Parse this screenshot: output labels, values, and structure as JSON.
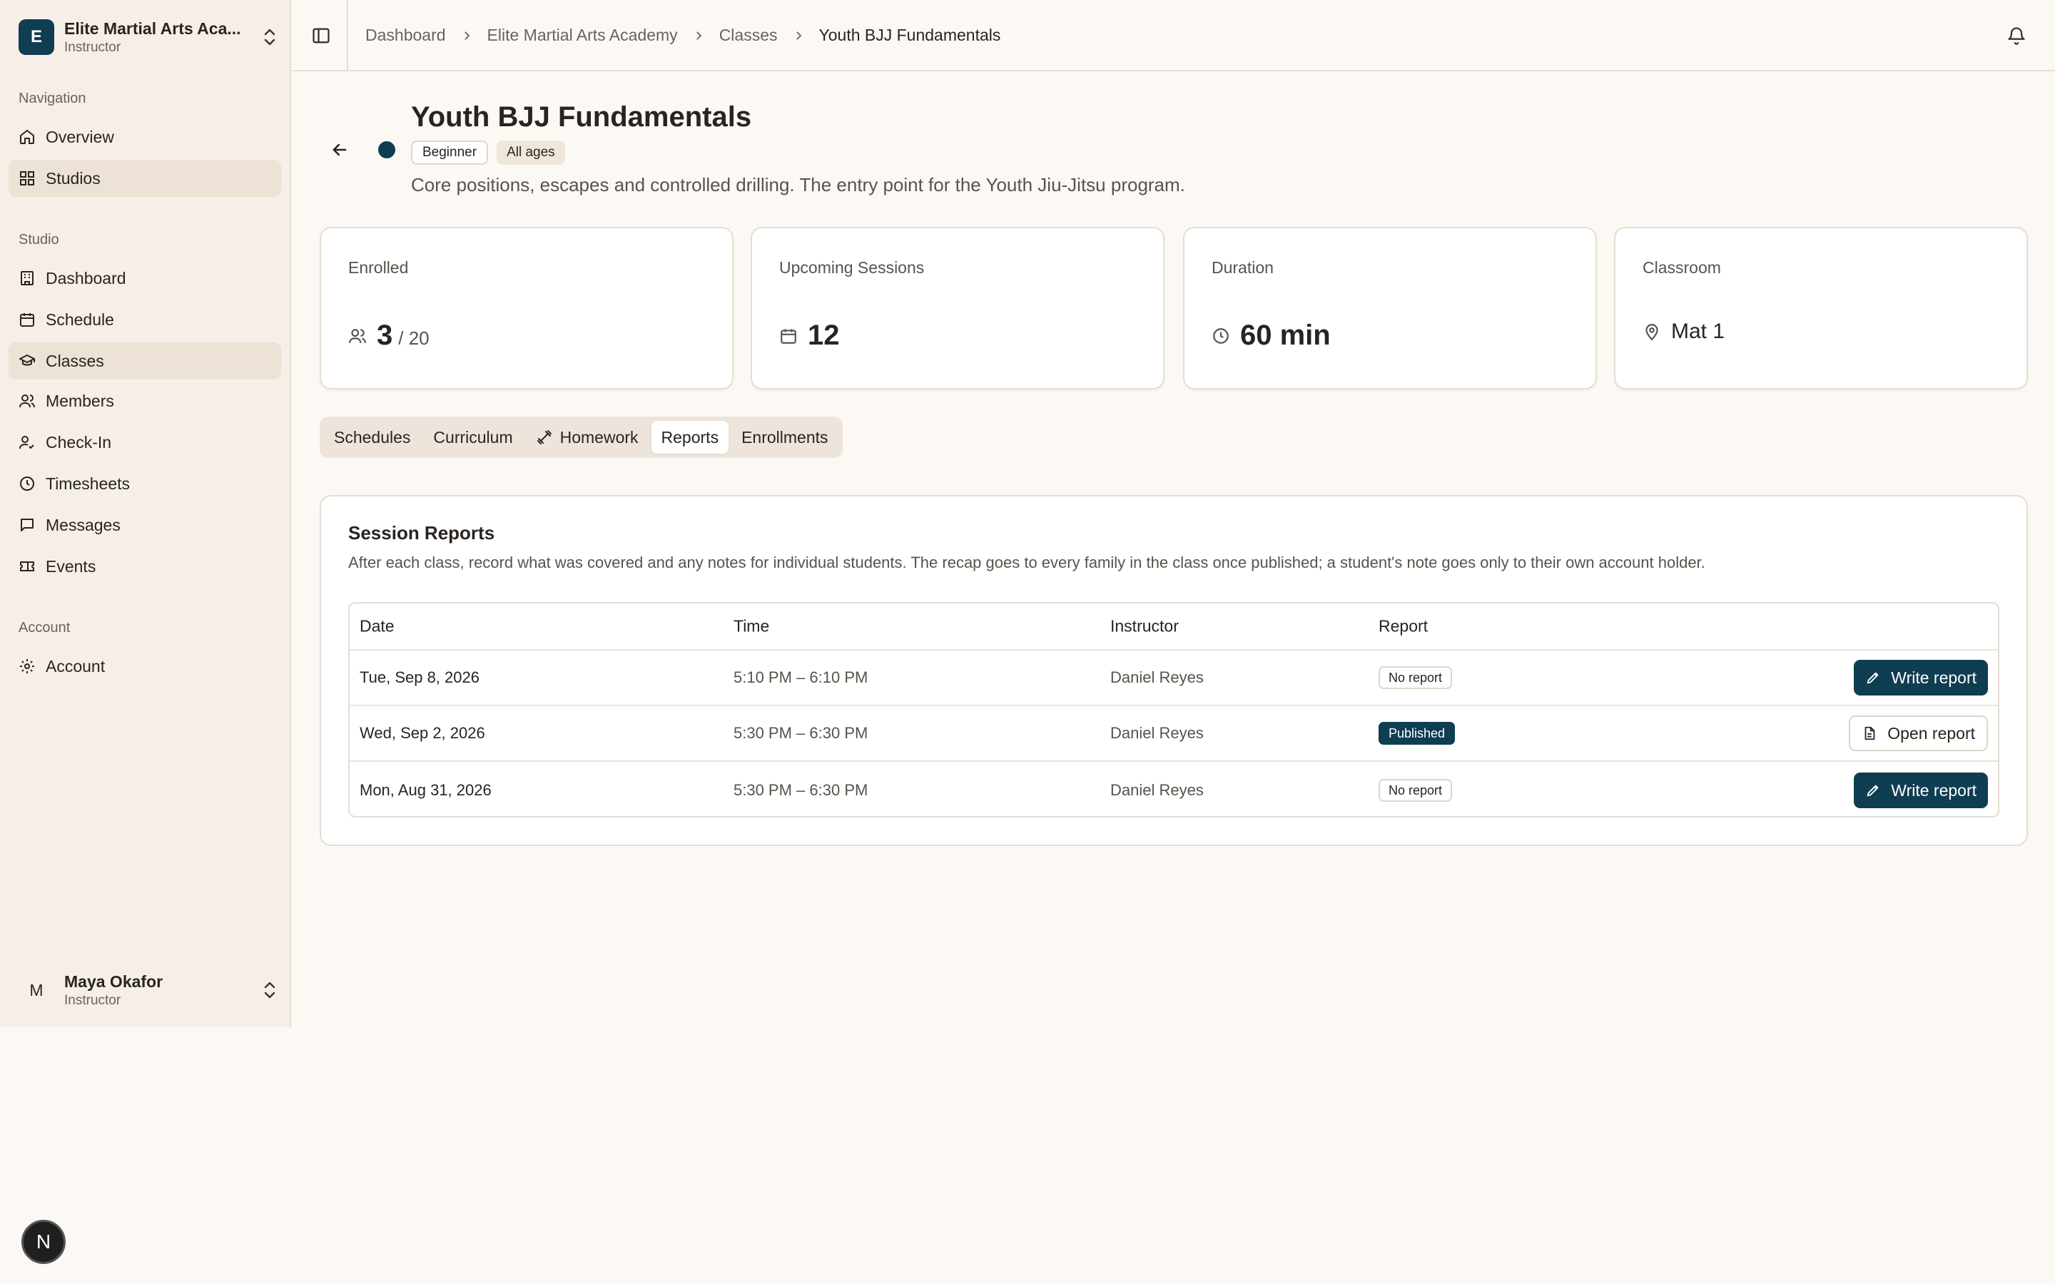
{
  "org": {
    "initial": "E",
    "name": "Elite Martial Arts Aca...",
    "role": "Instructor"
  },
  "sidebar": {
    "sections": {
      "navigation": "Navigation",
      "studio": "Studio",
      "account": "Account"
    },
    "navigation_items": [
      {
        "label": "Overview",
        "icon": "home-icon"
      },
      {
        "label": "Studios",
        "icon": "grid-icon"
      }
    ],
    "studio_items": [
      {
        "label": "Dashboard",
        "icon": "building-icon"
      },
      {
        "label": "Schedule",
        "icon": "calendar-icon"
      },
      {
        "label": "Classes",
        "icon": "graduation-cap-icon"
      },
      {
        "label": "Members",
        "icon": "users-icon"
      },
      {
        "label": "Check-In",
        "icon": "user-check-icon"
      },
      {
        "label": "Timesheets",
        "icon": "clock-icon"
      },
      {
        "label": "Messages",
        "icon": "message-icon"
      },
      {
        "label": "Events",
        "icon": "ticket-icon"
      }
    ],
    "account_items": [
      {
        "label": "Account",
        "icon": "gear-icon"
      }
    ]
  },
  "user": {
    "initial": "M",
    "name": "Maya Okafor",
    "role": "Instructor"
  },
  "breadcrumb": [
    "Dashboard",
    "Elite Martial Arts Academy",
    "Classes",
    "Youth BJJ Fundamentals"
  ],
  "class": {
    "title": "Youth BJJ Fundamentals",
    "badges": [
      "Beginner",
      "All ages"
    ],
    "description": "Core positions, escapes and controlled drilling. The entry point for the Youth Jiu-Jitsu program.",
    "color": "#0f3d52"
  },
  "stats": {
    "enrolled": {
      "label": "Enrolled",
      "value": "3",
      "capacity": "/ 20"
    },
    "upcoming": {
      "label": "Upcoming Sessions",
      "value": "12"
    },
    "duration": {
      "label": "Duration",
      "value": "60 min"
    },
    "classroom": {
      "label": "Classroom",
      "value": "Mat 1"
    }
  },
  "tabs": [
    "Schedules",
    "Curriculum",
    "Homework",
    "Reports",
    "Enrollments"
  ],
  "active_tab": "Reports",
  "reports": {
    "title": "Session Reports",
    "description": "After each class, record what was covered and any notes for individual students. The recap goes to every family in the class once published; a student's note goes only to their own account holder.",
    "columns": [
      "Date",
      "Time",
      "Instructor",
      "Report"
    ],
    "rows": [
      {
        "date": "Tue, Sep 8, 2026",
        "time": "5:10 PM – 6:10 PM",
        "instructor": "Daniel Reyes",
        "status": "No report",
        "action": "Write report"
      },
      {
        "date": "Wed, Sep 2, 2026",
        "time": "5:30 PM – 6:30 PM",
        "instructor": "Daniel Reyes",
        "status": "Published",
        "action": "Open report"
      },
      {
        "date": "Mon, Aug 31, 2026",
        "time": "5:30 PM – 6:30 PM",
        "instructor": "Daniel Reyes",
        "status": "No report",
        "action": "Write report"
      }
    ]
  },
  "dev_badge": "N",
  "colors": {
    "accent": "#0f3d52",
    "background": "#fcf9f5",
    "sidebar": "#f5efe8"
  }
}
